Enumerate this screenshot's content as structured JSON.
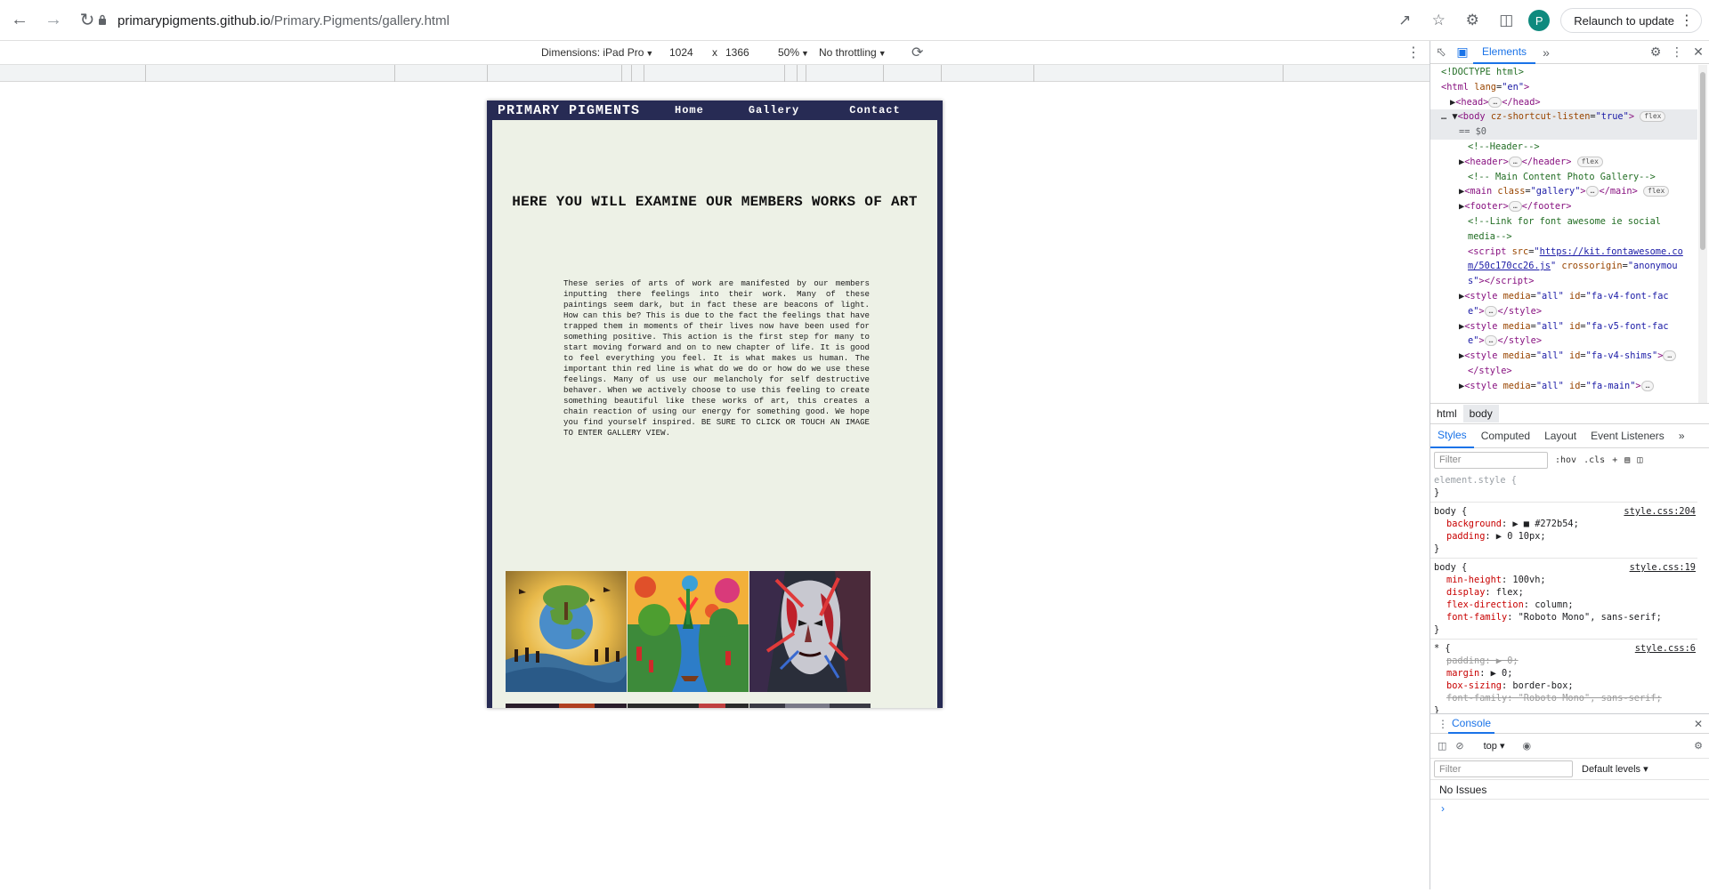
{
  "browser": {
    "url_domain": "primarypigments.github.io",
    "url_path": "/Primary.Pigments/gallery.html",
    "relaunch_label": "Relaunch to update",
    "profile_initial": "P"
  },
  "device_toolbar": {
    "dimensions_label": "Dimensions: iPad Pro",
    "width": "1024",
    "times": "x",
    "height": "1366",
    "zoom": "50%",
    "throttling": "No throttling"
  },
  "site": {
    "logo": "PRIMARY PIGMENTS",
    "nav": [
      "Home",
      "Gallery",
      "Contact"
    ],
    "heading": "HERE YOU WILL EXAMINE OUR MEMBERS WORKS OF ART",
    "paragraph": "These series of arts of work are manifested by our members inputting there feelings into their work. Many of these paintings seem dark, but in fact these are beacons of light. How can this be? This is due to the fact the feelings that have trapped them in moments of their lives now have been used for something positive. This action is the first step for many to start moving forward and on to new chapter of life. It is good to feel everything you feel. It is what makes us human. The important thin red line is what do we do or how do we use these feelings. Many of us use our melancholy for self destructive behaver. When we actively choose to use this feeling to create something beautiful like these works of art, this creates a chain reaction of using our energy for something good. We hope you find yourself inspired. BE SURE TO CLICK OR TOUCH AN IMAGE TO ENTER GALLERY VIEW.",
    "background_color": "#272b54",
    "gallery_bg_color": "#edf1e6"
  },
  "devtools": {
    "tabs": [
      "Elements"
    ],
    "dom_lines": [
      {
        "indent": 0,
        "html": "<span class='cm'>&lt;!DOCTYPE html&gt;</span>"
      },
      {
        "indent": 0,
        "html": "<span class='tag'>&lt;html</span> <span class='attr'>lang</span>=<span class='val'>\"en\"</span><span class='tag'>&gt;</span>"
      },
      {
        "indent": 1,
        "html": "▶<span class='tag'>&lt;head&gt;</span><span class='pill'>…</span><span class='tag'>&lt;/head&gt;</span>"
      },
      {
        "indent": 0,
        "html": "… ▼<span class='tag'>&lt;body</span> <span class='attr'>cz-shortcut-listen</span>=<span class='val'>\"true\"</span><span class='tag'>&gt;</span> <span class='pill'>flex</span>"
      },
      {
        "indent": 2,
        "html": "<span style='color:#5f6368'>== $0</span>"
      },
      {
        "indent": 3,
        "html": "<span class='cm'>&lt;!--Header--&gt;</span>"
      },
      {
        "indent": 2,
        "html": "▶<span class='tag'>&lt;header&gt;</span><span class='pill'>…</span><span class='tag'>&lt;/header&gt;</span> <span class='pill'>flex</span>"
      },
      {
        "indent": 3,
        "html": "<span class='cm'>&lt;!-- Main Content Photo Gallery--&gt;</span>"
      },
      {
        "indent": 2,
        "html": "▶<span class='tag'>&lt;main</span> <span class='attr'>class</span>=<span class='val'>\"gallery\"</span><span class='tag'>&gt;</span><span class='pill'>…</span><span class='tag'>&lt;/main&gt;</span> <span class='pill'>flex</span>"
      },
      {
        "indent": 2,
        "html": "▶<span class='tag'>&lt;footer&gt;</span><span class='pill'>…</span><span class='tag'>&lt;/footer&gt;</span>"
      },
      {
        "indent": 3,
        "html": "<span class='cm'>&lt;!--Link for font awesome ie social</span>"
      },
      {
        "indent": 3,
        "html": "<span class='cm'>media--&gt;</span>"
      },
      {
        "indent": 3,
        "html": "<span class='tag'>&lt;script</span> <span class='attr'>src</span>=<span class='val'>\"<span class='lnk'>https://kit.fontawesome.co</span></span>"
      },
      {
        "indent": 3,
        "html": "<span class='val'><span class='lnk'>m/50c170cc26.js</span>\"</span> <span class='attr'>crossorigin</span>=<span class='val'>\"anonymou</span>"
      },
      {
        "indent": 3,
        "html": "<span class='val'>s\"</span><span class='tag'>&gt;&lt;/script&gt;</span>"
      },
      {
        "indent": 2,
        "html": "▶<span class='tag'>&lt;style</span> <span class='attr'>media</span>=<span class='val'>\"all\"</span> <span class='attr'>id</span>=<span class='val'>\"fa-v4-font-fac</span>"
      },
      {
        "indent": 3,
        "html": "<span class='val'>e\"</span><span class='tag'>&gt;</span><span class='pill'>…</span><span class='tag'>&lt;/style&gt;</span>"
      },
      {
        "indent": 2,
        "html": "▶<span class='tag'>&lt;style</span> <span class='attr'>media</span>=<span class='val'>\"all\"</span> <span class='attr'>id</span>=<span class='val'>\"fa-v5-font-fac</span>"
      },
      {
        "indent": 3,
        "html": "<span class='val'>e\"</span><span class='tag'>&gt;</span><span class='pill'>…</span><span class='tag'>&lt;/style&gt;</span>"
      },
      {
        "indent": 2,
        "html": "▶<span class='tag'>&lt;style</span> <span class='attr'>media</span>=<span class='val'>\"all\"</span> <span class='attr'>id</span>=<span class='val'>\"fa-v4-shims\"</span><span class='tag'>&gt;</span><span class='pill'>…</span>"
      },
      {
        "indent": 3,
        "html": "<span class='tag'>&lt;/style&gt;</span>"
      },
      {
        "indent": 2,
        "html": "▶<span class='tag'>&lt;style</span> <span class='attr'>media</span>=<span class='val'>\"all\"</span> <span class='attr'>id</span>=<span class='val'>\"fa-main\"</span><span class='tag'>&gt;</span><span class='pill'>…</span>"
      }
    ],
    "breadcrumbs": [
      "html",
      "body"
    ],
    "style_tabs": [
      "Styles",
      "Computed",
      "Layout",
      "Event Listeners"
    ],
    "filter_placeholder": "Filter",
    "hov": ":hov",
    "cls": ".cls",
    "rules": [
      {
        "selector": "element.style {",
        "source": "",
        "props": []
      },
      {
        "selector": "body {",
        "source": "style.css:204",
        "props": [
          {
            "name": "background",
            "value": "▶ ■ #272b54;"
          },
          {
            "name": "padding",
            "value": "▶ 0 10px;"
          }
        ]
      },
      {
        "selector": "body {",
        "source": "style.css:19",
        "props": [
          {
            "name": "min-height",
            "value": "100vh;"
          },
          {
            "name": "display",
            "value": "flex;"
          },
          {
            "name": "flex-direction",
            "value": "column;"
          },
          {
            "name": "font-family",
            "value": "\"Roboto Mono\", sans-serif;"
          }
        ]
      },
      {
        "selector": "* {",
        "source": "style.css:6",
        "props": [
          {
            "name": "padding",
            "value": "▶ 0;",
            "struck": true
          },
          {
            "name": "margin",
            "value": "▶ 0;"
          },
          {
            "name": "box-sizing",
            "value": "border-box;"
          },
          {
            "name": "font-family",
            "value": "\"Roboto Mono\", sans-serif;",
            "struck": true
          }
        ]
      }
    ],
    "console": {
      "tab": "Console",
      "context": "top",
      "filter_placeholder": "Filter",
      "levels": "Default levels",
      "message": "No Issues",
      "prompt": "›"
    }
  }
}
